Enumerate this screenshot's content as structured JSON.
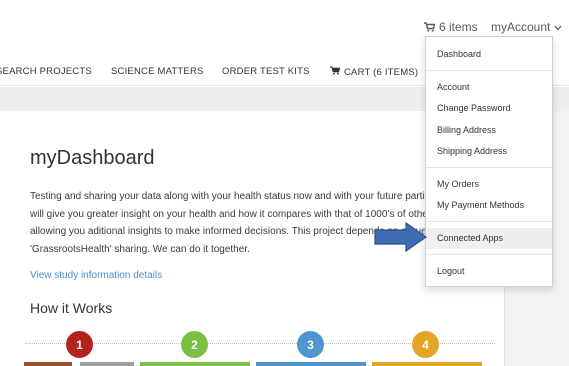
{
  "header": {
    "cart_count_label": "6 items",
    "account_label": "myAccount"
  },
  "nav": {
    "items": [
      {
        "label": "SEARCH PROJECTS"
      },
      {
        "label": "SCIENCE MATTERS"
      },
      {
        "label": "ORDER TEST KITS"
      },
      {
        "label": "CART (6 ITEMS)"
      }
    ]
  },
  "main": {
    "title": "myDashboard",
    "description_lines": [
      "Testing and sharing your data along with your health status now and with your future parti",
      "will give you greater insight on your health and how it compares with that of 1000’s of othe",
      "allowing you aditional insights to make informed decisions. This project depends on a true",
      "'GrassrootsHealth' sharing. We can do it together."
    ],
    "study_link": "View study information details",
    "how_it_works_title": "How it Works",
    "steps": [
      {
        "number": "1",
        "color": "#b3241f"
      },
      {
        "number": "2",
        "color": "#7ac143"
      },
      {
        "number": "3",
        "color": "#4f95cf"
      },
      {
        "number": "4",
        "color": "#e3a526"
      }
    ]
  },
  "dropdown": {
    "items": [
      {
        "label": "Dashboard"
      },
      {
        "label": "Account"
      },
      {
        "label": "Change Password"
      },
      {
        "label": "Billing Address"
      },
      {
        "label": "Shipping Address"
      },
      {
        "label": "My Orders"
      },
      {
        "label": "My Payment Methods"
      },
      {
        "label": "Connected Apps"
      },
      {
        "label": "Logout"
      }
    ],
    "highlighted": "Connected Apps"
  },
  "annotation": {
    "arrow_color": "#3f6db3"
  }
}
